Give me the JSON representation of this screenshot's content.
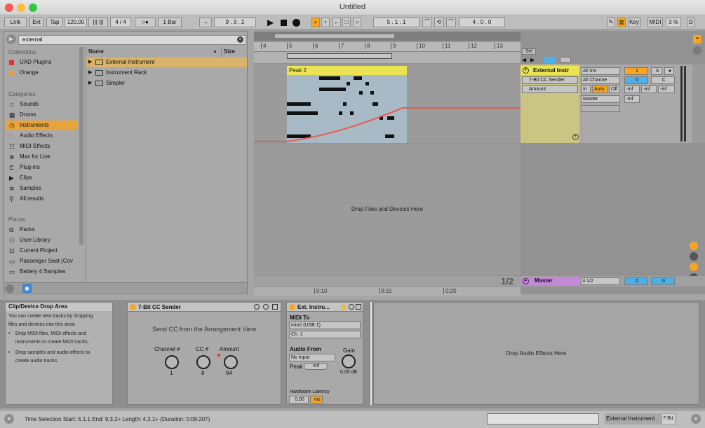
{
  "window": {
    "title": "Untitled"
  },
  "controlbar": {
    "link": "Link",
    "ext": "Ext",
    "tap": "Tap",
    "tempo": "120.00",
    "time_sig": "4 / 4",
    "metro": "○●",
    "quant": "1 Bar",
    "position": "9 . 3 . 2",
    "loop_start": "5 . 1 . 1",
    "loop_len": "4 . 0 . 0",
    "key": "Key",
    "midi": "MIDI",
    "cpu": "3 %",
    "d": "D"
  },
  "browser": {
    "search": "external",
    "collections_title": "Collections",
    "collections": [
      {
        "label": "UAD Plugins",
        "color": "#e53030"
      },
      {
        "label": "Orange",
        "color": "#f0a020"
      }
    ],
    "categories_title": "Categories",
    "categories": [
      {
        "label": "Sounds",
        "icon": "♫"
      },
      {
        "label": "Drums",
        "icon": "▦"
      },
      {
        "label": "Instruments",
        "icon": "◷"
      },
      {
        "label": "Audio Effects",
        "icon": "⫶"
      },
      {
        "label": "MIDI Effects",
        "icon": "☷"
      },
      {
        "label": "Max for Live",
        "icon": "⊕"
      },
      {
        "label": "Plug-ins",
        "icon": "⊏"
      },
      {
        "label": "Clips",
        "icon": "▶"
      },
      {
        "label": "Samples",
        "icon": "≋"
      },
      {
        "label": "All results",
        "icon": "⚲"
      }
    ],
    "places_title": "Places",
    "places": [
      {
        "label": "Packs",
        "icon": "⧉"
      },
      {
        "label": "User Library",
        "icon": "⚇"
      },
      {
        "label": "Current Project",
        "icon": "⊡"
      },
      {
        "label": "Passenger Seat (Cov",
        "icon": "▭"
      },
      {
        "label": "Battery 4 Samples",
        "icon": "▭"
      }
    ],
    "col_name": "Name",
    "col_size": "Size",
    "results": [
      {
        "label": "External Instrument"
      },
      {
        "label": "Instrument Rack"
      },
      {
        "label": "Simpler"
      }
    ]
  },
  "arrangement": {
    "ruler": [
      "4",
      "5",
      "6",
      "7",
      "8",
      "9",
      "10",
      "11",
      "12",
      "13"
    ],
    "clip_name": "Peak 2",
    "drop_text": "Drop Files and Devices Here",
    "set_label": "Set",
    "page": "1/2",
    "time_ticks": [
      "0:10",
      "0:15",
      "0:20"
    ]
  },
  "track": {
    "name": "External Instr",
    "device1": "7-Bit CC Sender",
    "param": "Amount",
    "input_type": "All Ins",
    "input_channel": "All Channe",
    "monitor_in": "In",
    "monitor_auto": "Auto",
    "monitor_off": "Off",
    "output": "Master",
    "track_num": "1",
    "solo": "S",
    "pan": "C",
    "vol": "0",
    "inf1": "-inf",
    "inf2": "-inf",
    "inf3": "-inf",
    "inf4": "-inf"
  },
  "master": {
    "name": "Master",
    "routing": "ii 1/2",
    "vol": "0",
    "vol2": "0"
  },
  "info": {
    "title": "Clip/Device Drop Area",
    "line1": "You can create new tracks by dropping",
    "line2": "files and devices into this area:",
    "b1a": "Drop MIDI files, MIDI effects and",
    "b1b": "instruments to create MIDI tracks.",
    "b2a": "Drop samples and audio effects to",
    "b2b": "create audio tracks."
  },
  "cc_sender": {
    "title": "7-Bit CC Sender",
    "desc": "Send CC from the Arrangement View",
    "k1_label": "Channel #",
    "k1_val": "1",
    "k2_label": "CC #",
    "k2_val": "8",
    "k3_label": "Amount",
    "k3_val": "64"
  },
  "ext_instr": {
    "title": "Ext. Instru...",
    "midi_to": "MIDI To",
    "midi_dev": "mio2 (USB 1)",
    "midi_ch": "Ch. 1",
    "audio_from": "Audio From",
    "audio_src": "No Input",
    "gain": "Gain",
    "gain_val": "0.00 dB",
    "peak": "Peak",
    "peak_val": "-Inf",
    "latency": "Hardware Latency",
    "latency_val": "0.00",
    "latency_unit": "ms"
  },
  "fx_drop": "Drop Audio Effects Here",
  "status": {
    "text": "Time Selection   Start: 5.1.1   End: 9.3.2+   Length: 4.2.1+  (Duration: 0:09:207)",
    "track": "External Instrument",
    "device": "7-Bit"
  }
}
